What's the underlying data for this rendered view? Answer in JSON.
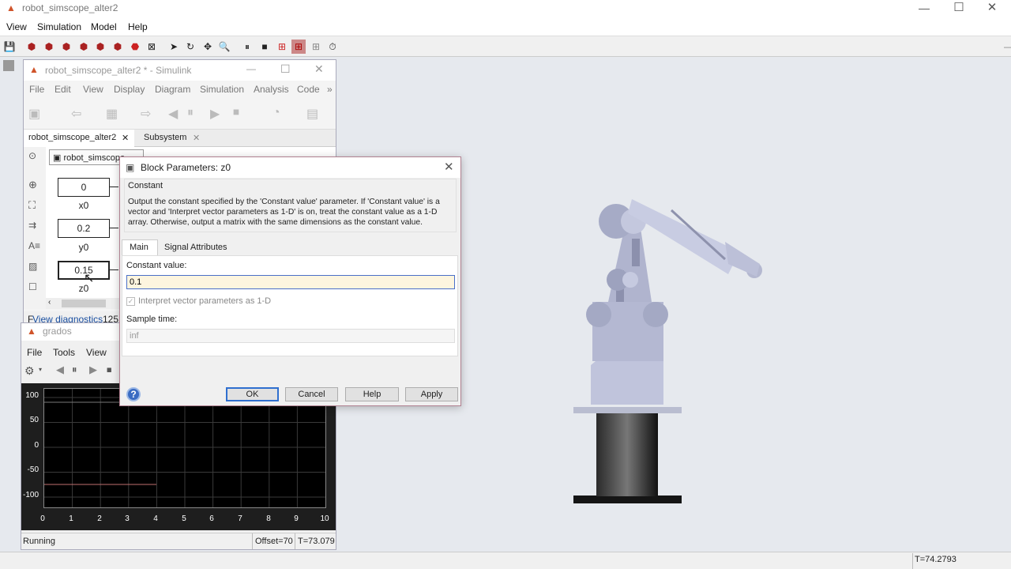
{
  "main": {
    "title": "robot_simscope_alter2",
    "menu": [
      "View",
      "Simulation",
      "Model",
      "Help"
    ],
    "status_time": "T=74.2793"
  },
  "simulink": {
    "title": "robot_simscope_alter2 * - Simulink",
    "menu": [
      "File",
      "Edit",
      "View",
      "Display",
      "Diagram",
      "Simulation",
      "Analysis",
      "Code"
    ],
    "tabs": [
      "robot_simscope_alter2",
      "Subsystem"
    ],
    "breadcrumb": "robot_simscope",
    "blocks": [
      {
        "value": "0",
        "label": "x0"
      },
      {
        "value": "0.2",
        "label": "y0"
      },
      {
        "value": "0.15",
        "label": "z0"
      }
    ],
    "status_link": "View diagnostics",
    "status_prefix": "F",
    "zoom": "125"
  },
  "scope": {
    "title": "grados",
    "menu": [
      "File",
      "Tools",
      "View"
    ],
    "status": "Running",
    "offset": "Offset=70",
    "time": "T=73.079",
    "y_ticks": [
      "100",
      "50",
      "0",
      "-50",
      "-100"
    ],
    "x_ticks": [
      "0",
      "1",
      "2",
      "3",
      "4",
      "5",
      "6",
      "7",
      "8",
      "9",
      "10"
    ]
  },
  "dialog": {
    "title": "Block Parameters: z0",
    "section": "Constant",
    "description": "Output the constant specified by the 'Constant value' parameter. If 'Constant value' is a vector and 'Interpret vector parameters as 1-D' is on, treat the constant value as a 1-D array. Otherwise, output a matrix with the same dimensions as the constant value.",
    "tabs": [
      "Main",
      "Signal Attributes"
    ],
    "constant_label": "Constant value:",
    "constant_value": "0.1",
    "checkbox_label": "Interpret vector parameters as 1-D",
    "sample_label": "Sample time:",
    "sample_value": "inf",
    "buttons": {
      "ok": "OK",
      "cancel": "Cancel",
      "help": "Help",
      "apply": "Apply"
    }
  }
}
